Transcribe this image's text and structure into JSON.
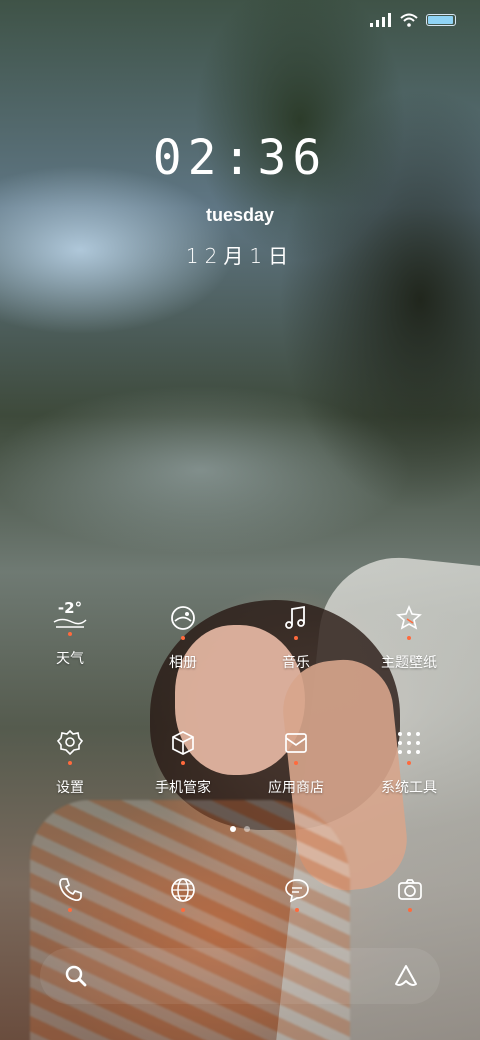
{
  "status_bar": {
    "signal": "signal-icon",
    "wifi": "wifi-icon",
    "battery": "battery-icon",
    "battery_level": 0.95
  },
  "lockscreen": {
    "time": "02:36",
    "day": "tuesday",
    "date": "12月1日"
  },
  "weather": {
    "temperature": "-2°"
  },
  "apps_row1": [
    {
      "label": "天气",
      "icon": "weather-icon"
    },
    {
      "label": "相册",
      "icon": "gallery-icon"
    },
    {
      "label": "音乐",
      "icon": "music-icon"
    },
    {
      "label": "主题壁纸",
      "icon": "theme-icon"
    }
  ],
  "apps_row2": [
    {
      "label": "设置",
      "icon": "settings-icon"
    },
    {
      "label": "手机管家",
      "icon": "phone-manager-icon"
    },
    {
      "label": "应用商店",
      "icon": "app-store-icon"
    },
    {
      "label": "系统工具",
      "icon": "system-tools-icon"
    }
  ],
  "dock": [
    {
      "icon": "phone-icon"
    },
    {
      "icon": "browser-icon"
    },
    {
      "icon": "messages-icon"
    },
    {
      "icon": "camera-icon"
    }
  ],
  "page_indicator": {
    "pages": 2,
    "current": 1
  },
  "search": {
    "search_icon": "search-icon",
    "assistant_icon": "assistant-icon"
  },
  "colors": {
    "accent_dot": "#ff6a3d",
    "battery": "#8fd3f4"
  }
}
